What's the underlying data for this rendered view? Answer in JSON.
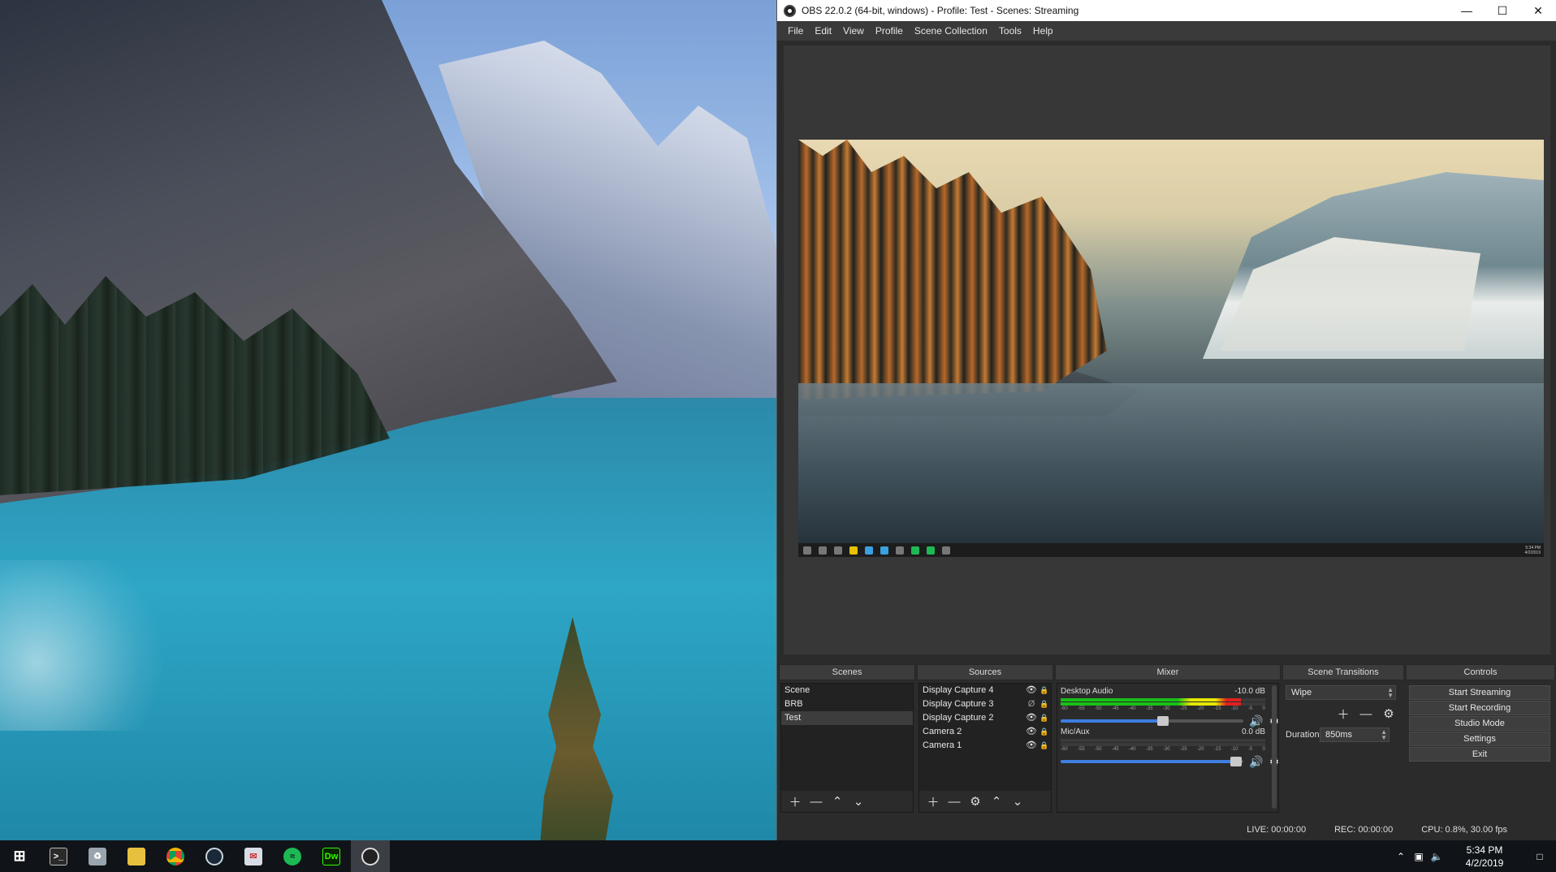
{
  "window": {
    "title": "OBS 22.0.2 (64-bit, windows) - Profile: Test - Scenes: Streaming",
    "controls": [
      "minimize",
      "maximize",
      "close"
    ]
  },
  "menu": [
    "File",
    "Edit",
    "View",
    "Profile",
    "Scene Collection",
    "Tools",
    "Help"
  ],
  "preview": {
    "mini_clock_time": "5:34 PM",
    "mini_clock_date": "4/2/2019"
  },
  "scenes": {
    "title": "Scenes",
    "items": [
      "Scene",
      "BRB",
      "Test"
    ],
    "selected": "Test"
  },
  "sources": {
    "title": "Sources",
    "items": [
      {
        "name": "Display Capture 4",
        "visible": true
      },
      {
        "name": "Display Capture 3",
        "visible": false
      },
      {
        "name": "Display Capture 2",
        "visible": true
      },
      {
        "name": "Camera 2",
        "visible": true
      },
      {
        "name": "Camera 1",
        "visible": true
      }
    ]
  },
  "mixer": {
    "title": "Mixer",
    "ticks": [
      "-60",
      "-55",
      "-50",
      "-45",
      "-40",
      "-35",
      "-30",
      "-25",
      "-20",
      "-15",
      "-10",
      "-5",
      "0"
    ],
    "channels": [
      {
        "name": "Desktop Audio",
        "db": "-10.0 dB",
        "meter_level": 0.88,
        "volume": 0.58
      },
      {
        "name": "Mic/Aux",
        "db": "0.0 dB",
        "meter_level": 0.0,
        "volume": 0.98
      }
    ]
  },
  "transitions": {
    "title": "Scene Transitions",
    "selected": "Wipe",
    "duration_label": "Duration",
    "duration_value": "850ms"
  },
  "controls": {
    "title": "Controls",
    "buttons": [
      "Start Streaming",
      "Start Recording",
      "Studio Mode",
      "Settings",
      "Exit"
    ]
  },
  "status": {
    "live": "LIVE: 00:00:00",
    "rec": "REC: 00:00:00",
    "cpu": "CPU: 0.8%, 30.00 fps"
  },
  "taskbar": {
    "apps": [
      "start",
      "terminal",
      "recycle",
      "file-explorer",
      "chrome",
      "steam",
      "mail",
      "spotify",
      "dreamweaver",
      "obs"
    ],
    "dreamweaver_label": "Dw",
    "clock_time": "5:34 PM",
    "clock_date": "4/2/2019"
  },
  "colors": {
    "obs_bg": "#2b2b2b",
    "meter_green": "#18c018",
    "meter_yellow": "#e6e600",
    "meter_red": "#e02020",
    "slider_blue": "#3d7ee0",
    "spotify_green": "#1db954"
  }
}
